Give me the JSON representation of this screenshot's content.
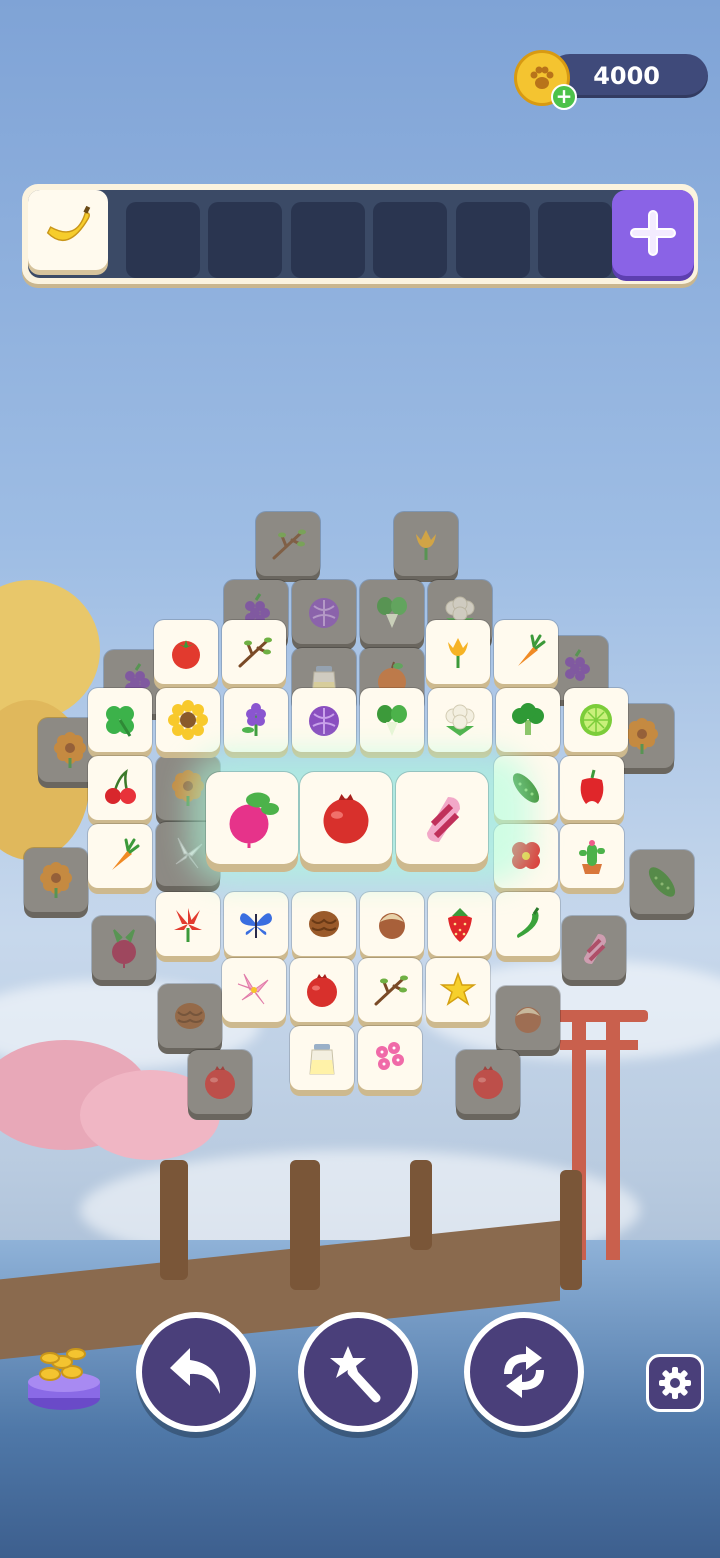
{
  "hud": {
    "coins": "4000",
    "coin_icon": "paw-coin-icon",
    "add_coins_icon": "plus-icon"
  },
  "tray": {
    "slots": 8,
    "filled": [
      "banana"
    ],
    "add_slot_icon": "plus-icon"
  },
  "board": {
    "tiles": [
      "twig",
      "tulip",
      "grapes",
      "cabbage",
      "bok-choy",
      "cauliflower",
      "tomato",
      "twig",
      "tulip",
      "carrot",
      "grapes",
      "milk-bottle",
      "apple",
      "clover",
      "sunflower",
      "lavender",
      "cabbage",
      "bok-choy",
      "cauliflower",
      "broccoli",
      "lime",
      "marigold",
      "marigold",
      "cherry",
      "pepper",
      "cucumber",
      "carrot",
      "cactus",
      "poppy",
      "lily",
      "marigold",
      "cucumber",
      "beet",
      "lily",
      "butterfly",
      "walnut",
      "hazelnut",
      "strawberry",
      "chili",
      "candy",
      "walnut",
      "lily",
      "pomegranate",
      "twig",
      "starfruit",
      "hazelnut",
      "pomegranate",
      "milk-bottle",
      "bougainvillea",
      "pomegranate"
    ],
    "highlighted_match": [
      "radish",
      "pomegranate",
      "candy"
    ]
  },
  "controls": {
    "undo_icon": "undo-arrow-icon",
    "magic_icon": "magic-wand-icon",
    "shuffle_icon": "shuffle-icon",
    "settings_icon": "gear-icon",
    "shop_icon": "coin-pot-icon"
  },
  "colors": {
    "tile_face": "#fffaee",
    "tile_dim": "#8d8a84",
    "tray_bg": "#3b4a66",
    "button_purple": "#4a3f7a",
    "add_slot": "#8a63e6",
    "glow": "#aaffdc"
  }
}
